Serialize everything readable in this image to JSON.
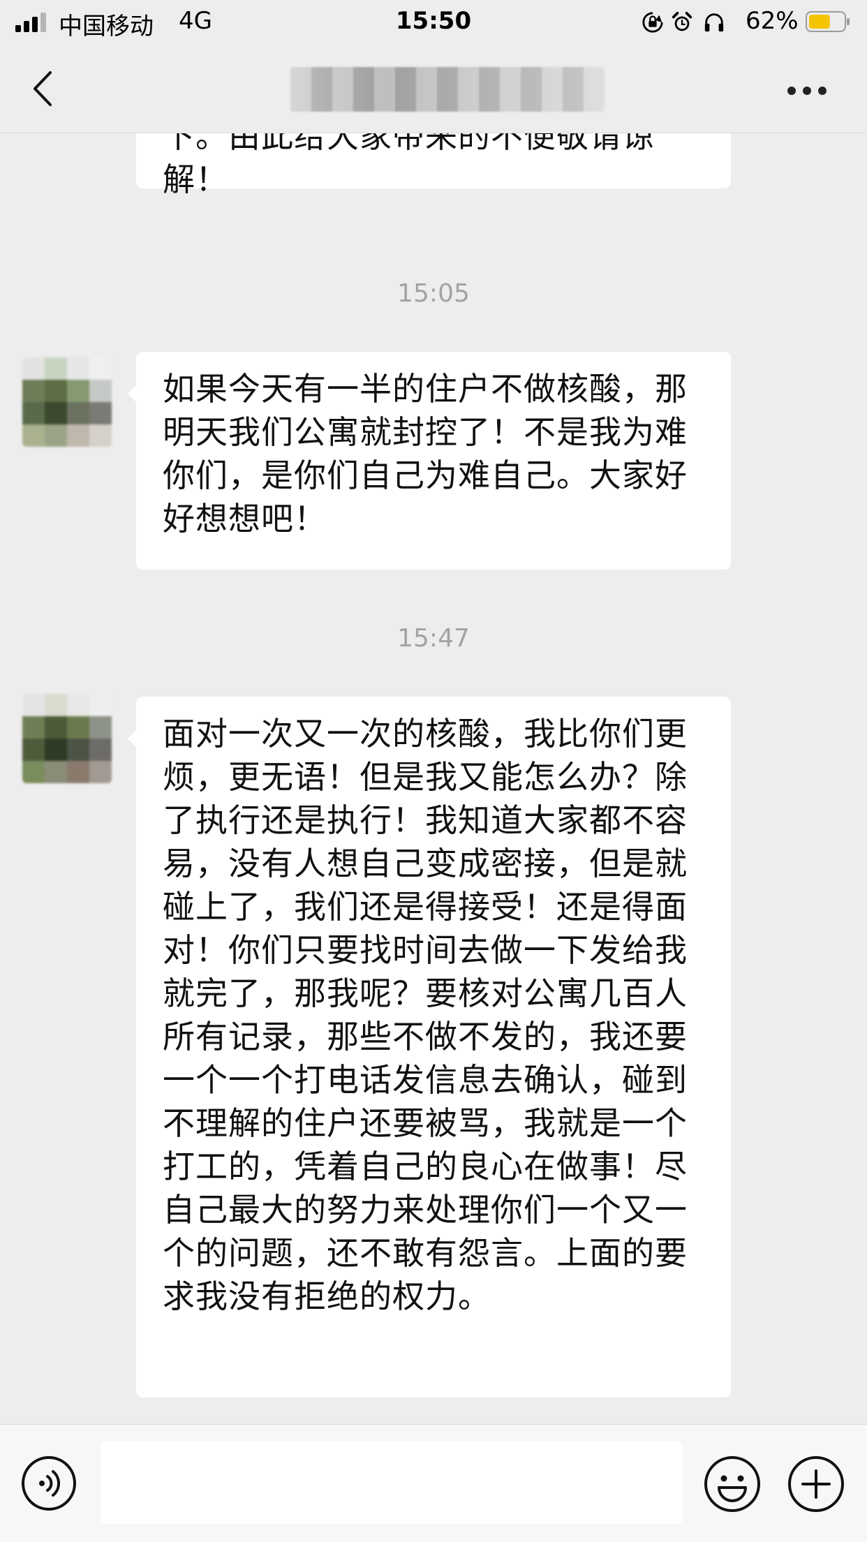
{
  "status_bar": {
    "carrier": "中国移动",
    "network": "4G",
    "time": "15:50",
    "battery_percent": "62%",
    "battery_level": 0.62,
    "battery_color": "#f5c400",
    "icons": [
      "rotation-lock-icon",
      "alarm-icon",
      "headphones-icon",
      "battery-icon"
    ]
  },
  "nav": {
    "back_icon": "chevron-left-icon",
    "title": "",
    "more_icon": "more-dots-icon"
  },
  "messages": [
    {
      "type": "text",
      "text": "下。由此给大家带来的不便敬请谅解！"
    },
    {
      "type": "time",
      "text": "15:05"
    },
    {
      "type": "text",
      "text": "如果今天有一半的住户不做核酸，那明天我们公寓就封控了！不是我为难你们，是你们自己为难自己。大家好好想想吧！"
    },
    {
      "type": "time",
      "text": "15:47"
    },
    {
      "type": "text",
      "text": "面对一次又一次的核酸，我比你们更烦，更无语！但是我又能怎么办？除了执行还是执行！我知道大家都不容易，没有人想自己变成密接，但是就碰上了，我们还是得接受！还是得面对！你们只要找时间去做一下发给我就完了，那我呢？要核对公寓几百人所有记录，那些不做不发的，我还要一个一个打电话发信息去确认，碰到不理解的住户还要被骂，我就是一个打工的，凭着自己的良心在做事！尽自己最大的努力来处理你们一个又一个的问题，还不敢有怨言。上面的要求我没有拒绝的权力。"
    }
  ],
  "input_bar": {
    "voice_icon": "voice-icon",
    "input_value": "",
    "emoji_icon": "emoji-icon",
    "plus_icon": "plus-icon"
  }
}
